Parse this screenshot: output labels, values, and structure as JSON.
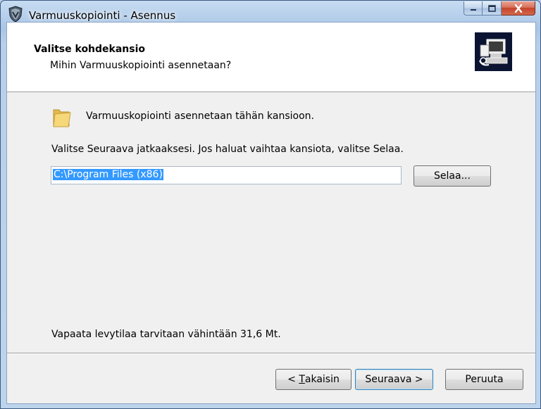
{
  "window": {
    "title": "Varmuuskopiointi - Asennus",
    "icon": "shield-app-icon",
    "controls": [
      "minimize-icon",
      "maximize-icon",
      "close-icon"
    ]
  },
  "header": {
    "title": "Valitse kohdekansio",
    "subtitle": "Mihin Varmuuskopiointi asennetaan?",
    "image": "computer-installer-icon"
  },
  "main": {
    "folder_icon": "folder-icon",
    "install_text": "Varmuuskopiointi asennetaan tähän kansioon.",
    "instruction": "Valitse Seuraava jatkaaksesi. Jos haluat vaihtaa kansiota, valitse Selaa.",
    "path_value": "C:\\Program Files (x86)",
    "browse_label": "Selaa...",
    "space_required": "Vapaata levytilaa tarvitaan vähintään 31,6 Mt."
  },
  "footer": {
    "back_prefix": "< ",
    "back_mnemonic": "T",
    "back_rest": "akaisin",
    "next_label": "Seuraava >",
    "cancel_label": "Peruuta"
  },
  "colors": {
    "selection": "#3399ff",
    "client_bg": "#f0f0f0",
    "header_bg": "#ffffff",
    "close_button": "#c4432a"
  }
}
